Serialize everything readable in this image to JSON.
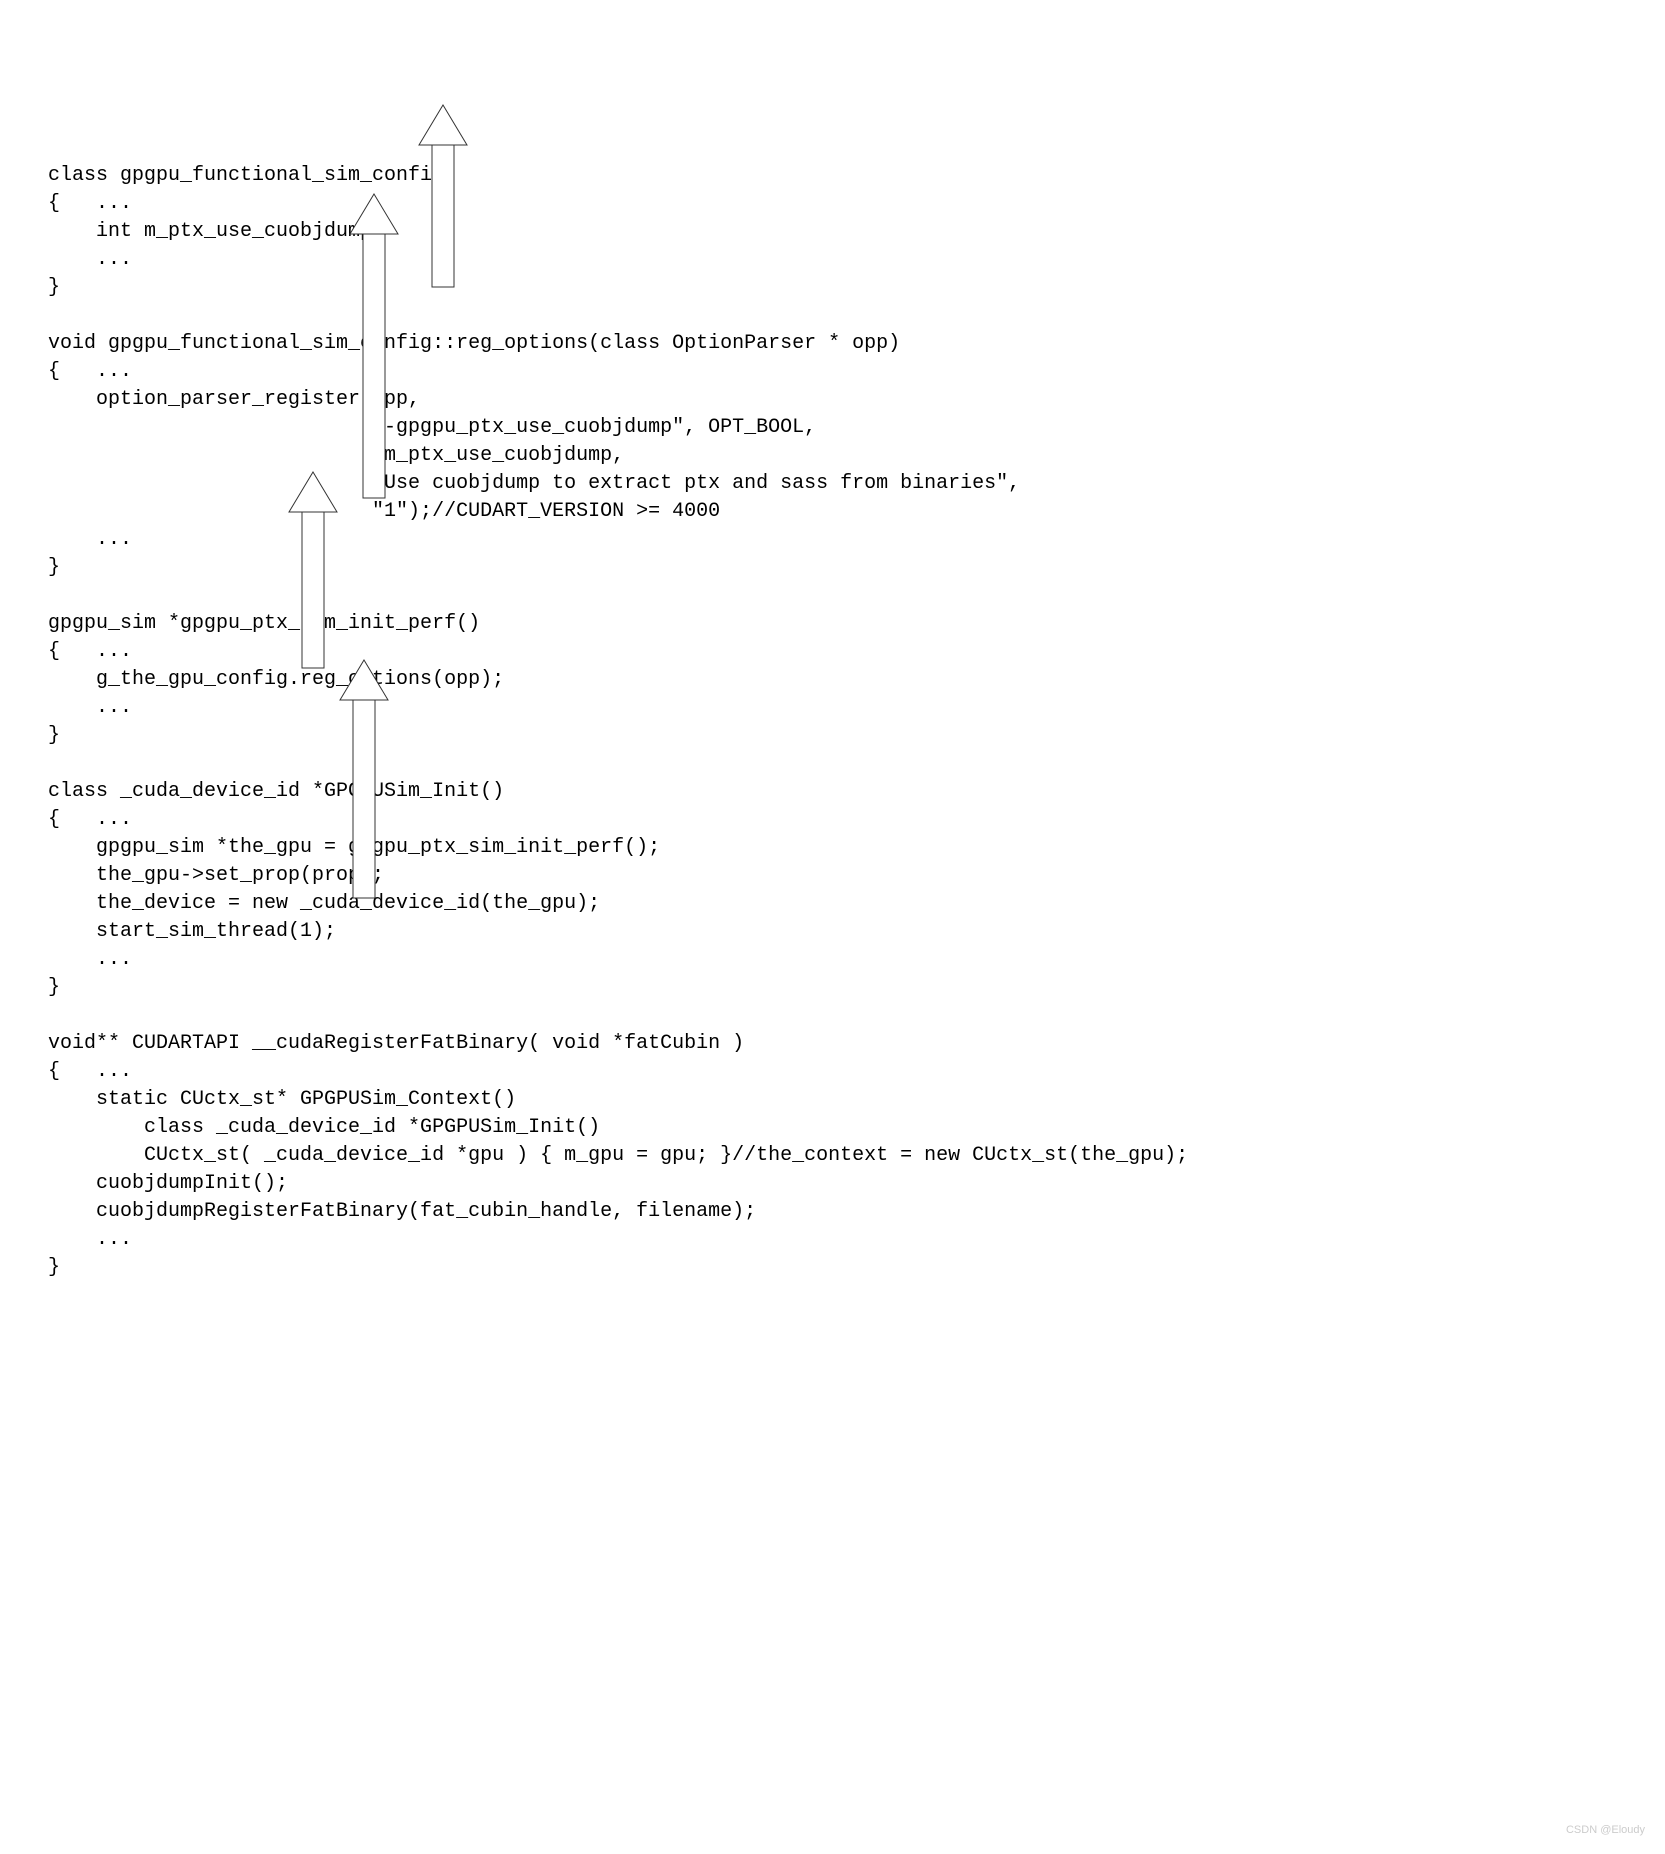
{
  "code": {
    "line1": "class gpgpu_functional_sim_config",
    "line2": "{   ...",
    "line3": "    int m_ptx_use_cuobjdump;",
    "line4": "    ...",
    "line5": "}",
    "line6": "",
    "line7": "void gpgpu_functional_sim_config::reg_options(class OptionParser * opp)",
    "line8": "{   ...",
    "line9": "    option_parser_register(opp,",
    "line10": "                           \"-gpgpu_ptx_use_cuobjdump\", OPT_BOOL,",
    "line11": "                           &m_ptx_use_cuobjdump,",
    "line12": "                           \"Use cuobjdump to extract ptx and sass from binaries\",",
    "line13": "                           \"1\");//CUDART_VERSION >= 4000",
    "line14": "    ...",
    "line15": "}",
    "line16": "",
    "line17": "gpgpu_sim *gpgpu_ptx_sim_init_perf()",
    "line18": "{   ...",
    "line19": "    g_the_gpu_config.reg_options(opp);",
    "line20": "    ...",
    "line21": "}",
    "line22": "",
    "line23": "class _cuda_device_id *GPGPUSim_Init()",
    "line24": "{   ...",
    "line25": "    gpgpu_sim *the_gpu = gpgpu_ptx_sim_init_perf();",
    "line26": "    the_gpu->set_prop(prop);",
    "line27": "    the_device = new _cuda_device_id(the_gpu);",
    "line28": "    start_sim_thread(1);",
    "line29": "    ...",
    "line30": "}",
    "line31": "",
    "line32": "void** CUDARTAPI __cudaRegisterFatBinary( void *fatCubin )",
    "line33": "{   ...",
    "line34": "    static CUctx_st* GPGPUSim_Context()",
    "line35": "        class _cuda_device_id *GPGPUSim_Init()",
    "line36": "        CUctx_st( _cuda_device_id *gpu ) { m_gpu = gpu; }//the_context = new CUctx_st(the_gpu);",
    "line37": "    cuobjdumpInit();",
    "line38": "    cuobjdumpRegisterFatBinary(fat_cubin_handle, filename);",
    "line39": "    ...",
    "line40": "}"
  },
  "arrows": {
    "stroke": "#333333",
    "strokeWidth": 1,
    "fill": "#ffffff"
  },
  "watermark": "CSDN @Eloudy"
}
